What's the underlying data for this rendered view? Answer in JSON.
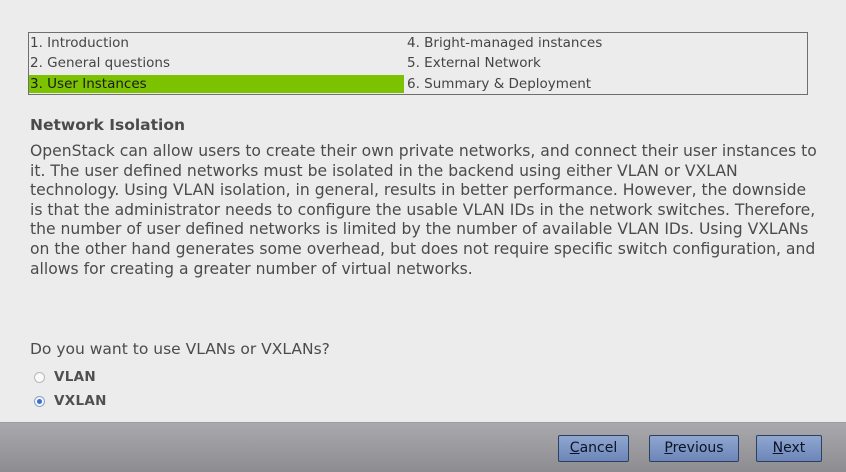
{
  "wizard_steps": [
    {
      "label": "1. Introduction",
      "active": false
    },
    {
      "label": "2. General questions",
      "active": false
    },
    {
      "label": "3. User Instances",
      "active": true
    },
    {
      "label": "4. Bright-managed instances",
      "active": false
    },
    {
      "label": "5. External Network",
      "active": false
    },
    {
      "label": "6. Summary & Deployment",
      "active": false
    }
  ],
  "section": {
    "title": "Network Isolation",
    "description": "OpenStack can allow users to create their own private networks, and connect their user instances to it. The user defined networks must be isolated in the backend using either VLAN or VXLAN technology. Using VLAN isolation, in general, results in better performance. However, the downside is that the administrator needs to configure the usable VLAN IDs in the network switches. Therefore, the number of user defined networks is limited by the number of available VLAN IDs. Using VXLANs on the other hand generates some overhead, but does not require specific switch configuration, and allows for creating a greater number of virtual networks."
  },
  "question": {
    "text": "Do you want to use VLANs or VXLANs?",
    "options": [
      {
        "label": "VLAN",
        "selected": false
      },
      {
        "label": "VXLAN",
        "selected": true
      }
    ]
  },
  "buttons": {
    "cancel": {
      "mnemonic": "C",
      "rest": "ancel"
    },
    "previous": {
      "mnemonic": "P",
      "rest": "revious"
    },
    "next": {
      "mnemonic": "N",
      "rest": "ext"
    }
  },
  "colors": {
    "active_step": "#7cc200",
    "selected_radio": "#3a6fd0"
  }
}
